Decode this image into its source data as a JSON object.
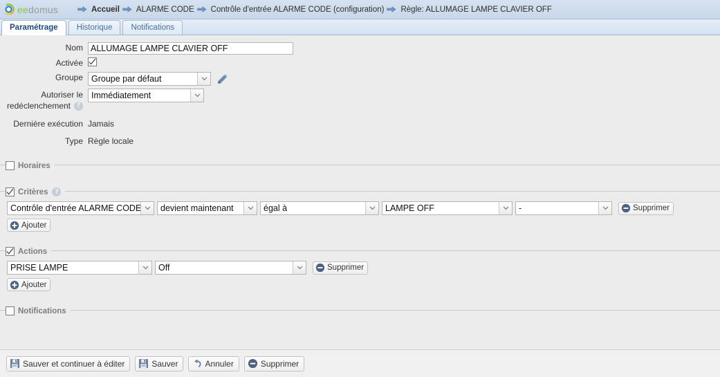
{
  "header": {
    "logo": {
      "icon": "eedomus-logo-icon",
      "text_primary": "ee",
      "text_secondary": "domus"
    },
    "breadcrumb": [
      {
        "label": "Accueil",
        "bold": true,
        "icon": "arrow-right-icon"
      },
      {
        "label": "ALARME CODE",
        "bold": false,
        "icon": "arrow-right-icon"
      },
      {
        "label": "Contrôle d'entrée ALARME CODE (configuration)",
        "bold": false,
        "icon": "arrow-right-icon"
      },
      {
        "label": "Règle: ALLUMAGE LAMPE CLAVIER OFF",
        "bold": false,
        "icon": "arrow-right-icon"
      }
    ]
  },
  "tabs": [
    {
      "label": "Paramétrage",
      "active": true
    },
    {
      "label": "Historique",
      "active": false
    },
    {
      "label": "Notifications",
      "active": false
    }
  ],
  "form": {
    "nom": {
      "label": "Nom",
      "value": "ALLUMAGE LAMPE CLAVIER OFF",
      "placeholder": ""
    },
    "activee": {
      "label": "Activée",
      "checked": true
    },
    "groupe": {
      "label": "Groupe",
      "value": "Groupe par défaut",
      "edit_icon": "pencil-icon"
    },
    "redeclenchement": {
      "label_line1": "Autoriser le",
      "label_line2": "redéclenchement",
      "value": "Immédiatement",
      "help_icon": "help-icon",
      "help_glyph": "?"
    },
    "derniere_execution": {
      "label": "Dernière exécution",
      "value": "Jamais"
    },
    "type": {
      "label": "Type",
      "value": "Règle locale"
    }
  },
  "sections": {
    "horaires": {
      "title": "Horaires",
      "checked": false
    },
    "criteres": {
      "title": "Critères",
      "checked": true,
      "help_glyph": "?",
      "rows": [
        {
          "source": "Contrôle d'entrée ALARME CODE",
          "event": "devient maintenant",
          "operator": "égal à",
          "value": "LAMPE OFF",
          "extra": "-",
          "delete_label": "Supprimer"
        }
      ],
      "add_label": "Ajouter"
    },
    "actions": {
      "title": "Actions",
      "checked": true,
      "rows": [
        {
          "target": "PRISE LAMPE",
          "command": "Off",
          "delete_label": "Supprimer"
        }
      ],
      "add_label": "Ajouter"
    },
    "notifications": {
      "title": "Notifications",
      "checked": false
    }
  },
  "footer": {
    "buttons": [
      {
        "label": "Sauver et continuer à éditer",
        "icon": "save-icon"
      },
      {
        "label": "Sauver",
        "icon": "save-icon"
      },
      {
        "label": "Annuler",
        "icon": "undo-icon"
      },
      {
        "label": "Supprimer",
        "icon": "minus-circle-icon"
      }
    ]
  },
  "colors": {
    "header_bg": "#cfdcec",
    "page_bg": "#ececec",
    "accent_blue": "#5b7ba8",
    "logo_green": "#8cc63e",
    "logo_gray": "#9a9a9a",
    "tab_active_text": "#1b4a80"
  }
}
